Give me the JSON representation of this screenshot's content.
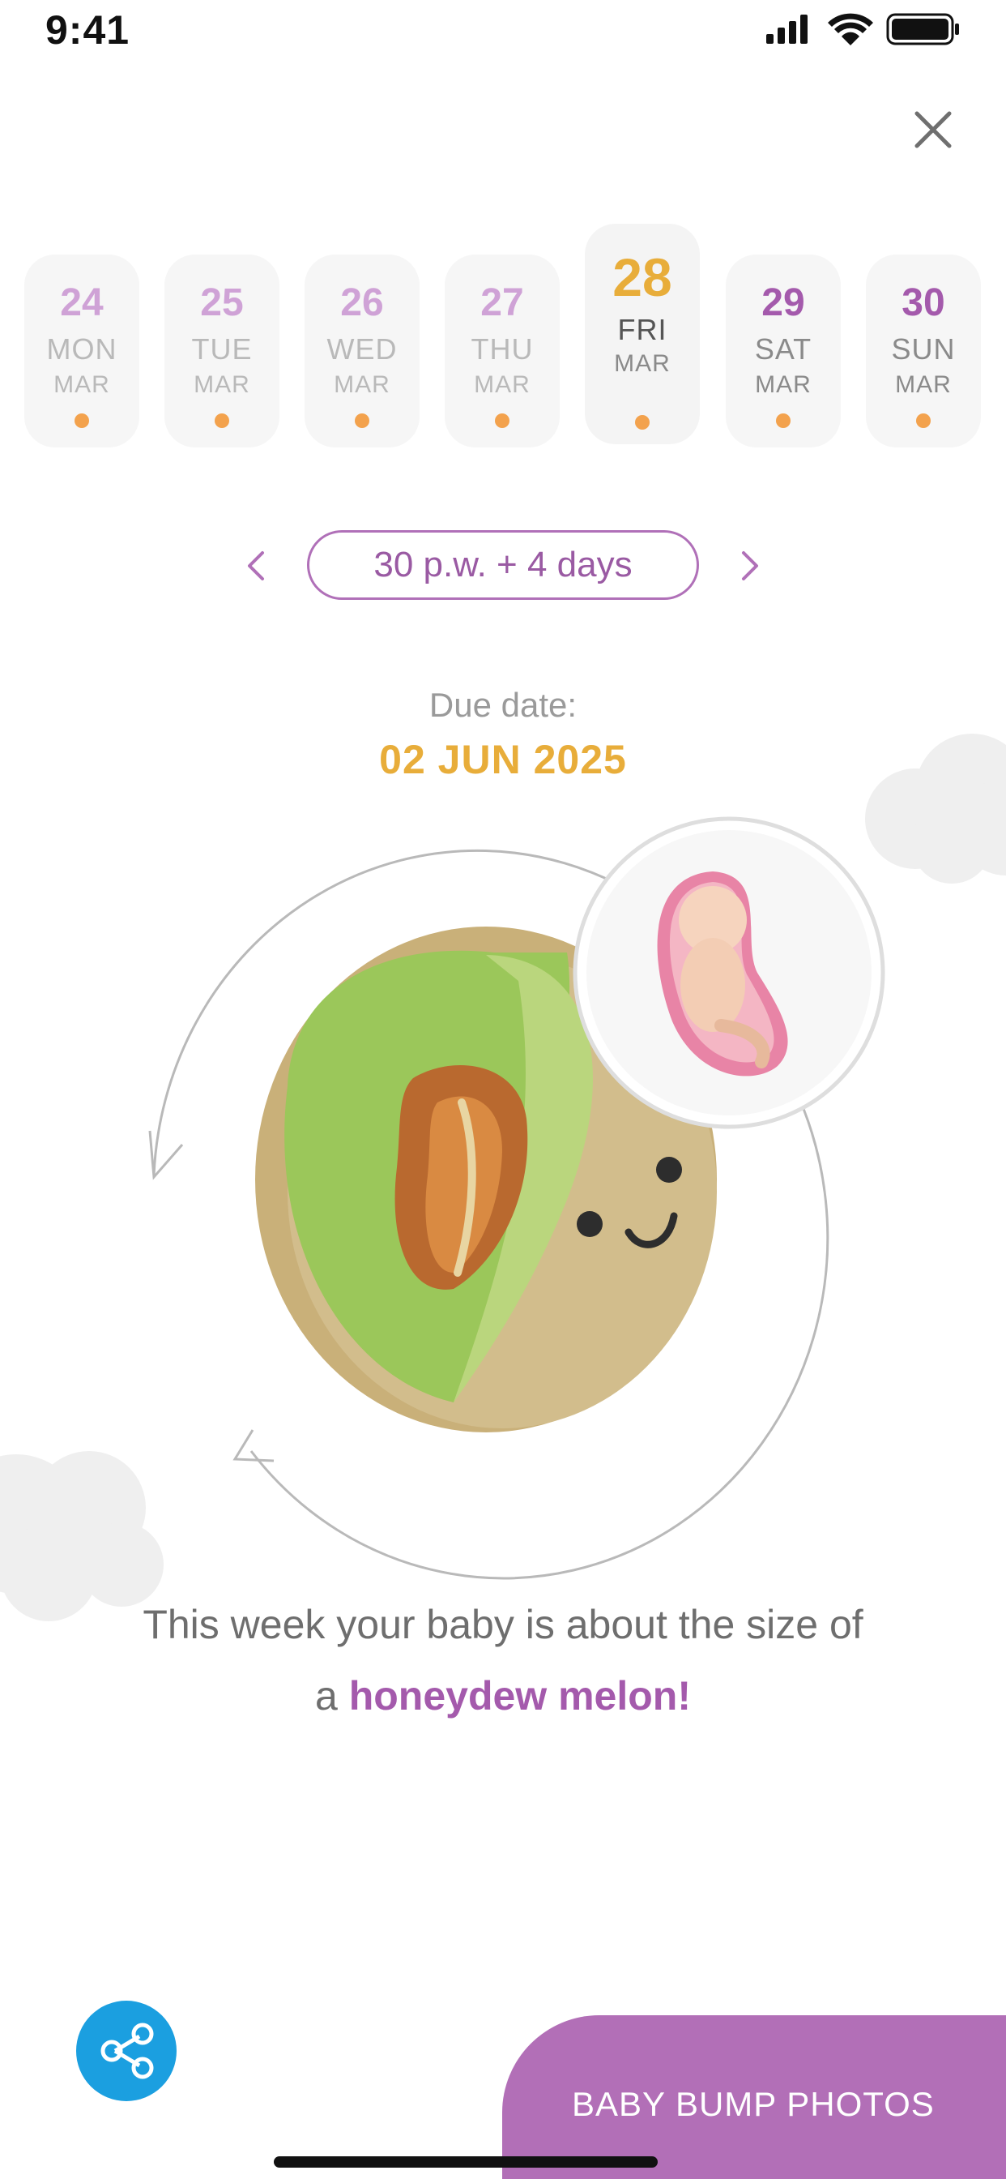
{
  "status_bar": {
    "time": "9:41"
  },
  "days": [
    {
      "num": "24",
      "name": "MON",
      "month": "MAR",
      "state": "past"
    },
    {
      "num": "25",
      "name": "TUE",
      "month": "MAR",
      "state": "past"
    },
    {
      "num": "26",
      "name": "WED",
      "month": "MAR",
      "state": "past"
    },
    {
      "num": "27",
      "name": "THU",
      "month": "MAR",
      "state": "past"
    },
    {
      "num": "28",
      "name": "FRI",
      "month": "MAR",
      "state": "selected"
    },
    {
      "num": "29",
      "name": "SAT",
      "month": "MAR",
      "state": "future"
    },
    {
      "num": "30",
      "name": "SUN",
      "month": "MAR",
      "state": "future"
    }
  ],
  "week": {
    "label": "30 p.w. + 4 days"
  },
  "due": {
    "label": "Due date:",
    "value": "02 JUN 2025"
  },
  "size": {
    "prefix": "This week your baby is about the size of",
    "article": "a",
    "fruit": "honeydew melon!"
  },
  "actions": {
    "bump_photos": "BABY BUMP PHOTOS"
  },
  "icons": {
    "close": "close-icon",
    "share": "share-icon",
    "prev": "chevron-left-icon",
    "next": "chevron-right-icon"
  },
  "colors": {
    "accent_purple": "#a45aac",
    "accent_gold": "#e8ad3a",
    "dot_orange": "#f3a24d",
    "share_blue": "#1b9fe0",
    "bump_purple": "#b26fb7"
  }
}
